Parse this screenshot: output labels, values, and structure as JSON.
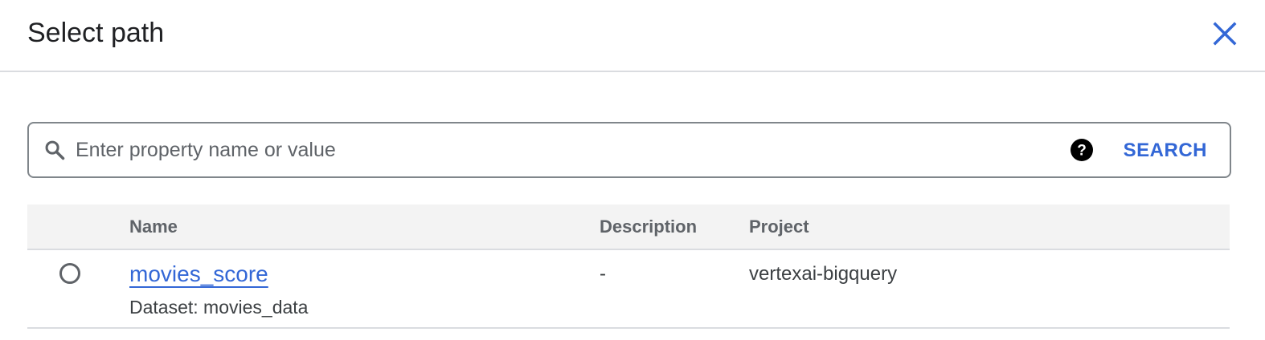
{
  "dialog": {
    "title": "Select path",
    "close_icon": "close-icon"
  },
  "search": {
    "placeholder": "Enter property name or value",
    "value": "",
    "search_icon": "search-icon",
    "help_icon": "help-icon",
    "button_label": "SEARCH"
  },
  "table": {
    "columns": [
      "Name",
      "Description",
      "Project"
    ],
    "rows": [
      {
        "name": "movies_score",
        "subtitle": "Dataset: movies_data",
        "description": "-",
        "project": "vertexai-bigquery",
        "selected": false
      }
    ]
  },
  "colors": {
    "accent": "#3367d6",
    "header_bg": "#f3f3f3",
    "divider": "#dadce0"
  }
}
